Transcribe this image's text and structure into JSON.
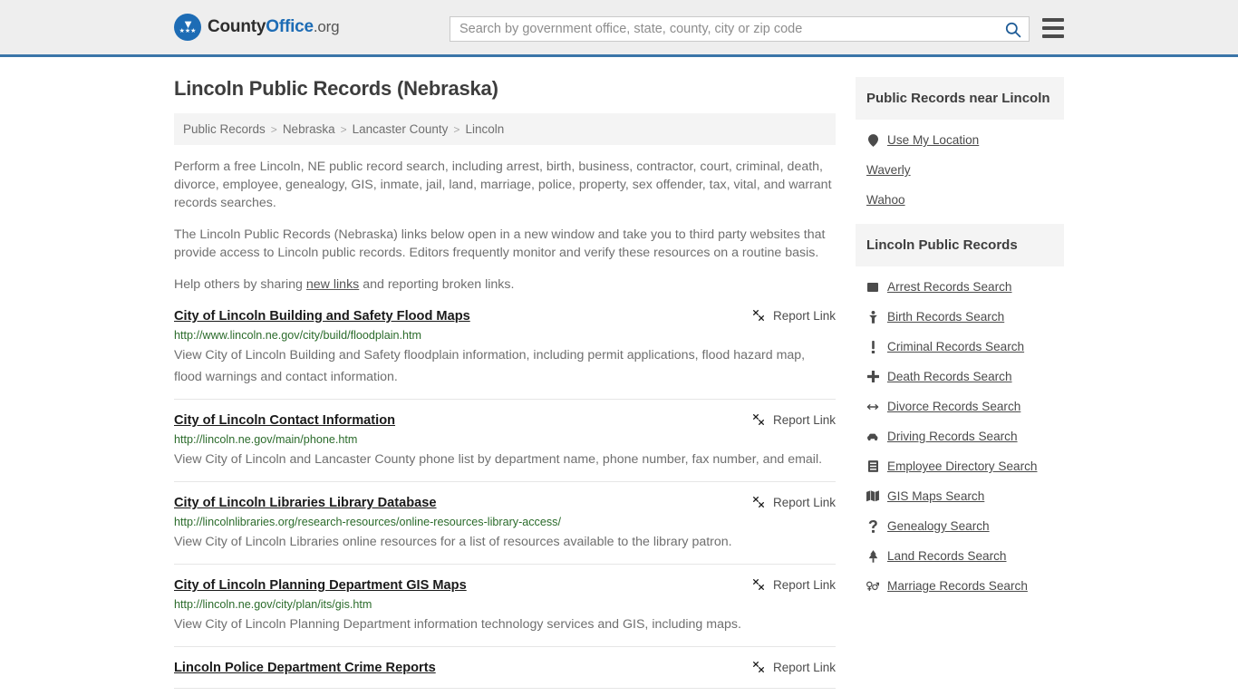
{
  "header": {
    "logo": {
      "part1": "County",
      "part2": "Office",
      "suffix": ".org",
      "icon": "eagle-shield-logo"
    },
    "search": {
      "placeholder": "Search by government office, state, county, city or zip code",
      "value": "",
      "icon": "search-icon"
    },
    "menu_icon": "hamburger-menu-icon",
    "accent_color": "#3a75a8"
  },
  "page": {
    "title": "Lincoln Public Records (Nebraska)"
  },
  "breadcrumb": {
    "items": [
      {
        "label": "Public Records",
        "link": true
      },
      {
        "label": "Nebraska",
        "link": true
      },
      {
        "label": "Lancaster County",
        "link": true
      },
      {
        "label": "Lincoln",
        "link": false
      }
    ],
    "separator": ">"
  },
  "intro": {
    "paragraph1": "Perform a free Lincoln, NE public record search, including arrest, birth, business, contractor, court, criminal, death, divorce, employee, genealogy, GIS, inmate, jail, land, marriage, police, property, sex offender, tax, vital, and warrant records searches.",
    "paragraph2": "The Lincoln Public Records (Nebraska) links below open in a new window and take you to third party websites that provide access to Lincoln public records. Editors frequently monitor and verify these resources on a routine basis.",
    "paragraph3_before": "Help others by sharing ",
    "paragraph3_link": "new links",
    "paragraph3_after": " and reporting broken links."
  },
  "results": {
    "report_label": "Report Link",
    "report_icon": "broken-link-icon",
    "items": [
      {
        "title": "City of Lincoln Building and Safety Flood Maps",
        "url": "http://www.lincoln.ne.gov/city/build/floodplain.htm",
        "description": "View City of Lincoln Building and Safety floodplain information, including permit applications, flood hazard map, flood warnings and contact information."
      },
      {
        "title": "City of Lincoln Contact Information",
        "url": "http://lincoln.ne.gov/main/phone.htm",
        "description": "View City of Lincoln and Lancaster County phone list by department name, phone number, fax number, and email."
      },
      {
        "title": "City of Lincoln Libraries Library Database",
        "url": "http://lincolnlibraries.org/research-resources/online-resources-library-access/",
        "description": "View City of Lincoln Libraries online resources for a list of resources available to the library patron."
      },
      {
        "title": "City of Lincoln Planning Department GIS Maps",
        "url": "http://lincoln.ne.gov/city/plan/its/gis.htm",
        "description": "View City of Lincoln Planning Department information technology services and GIS, including maps."
      },
      {
        "title": "Lincoln Police Department Crime Reports",
        "url": "",
        "description": ""
      }
    ]
  },
  "sidebar": {
    "near_panel": {
      "title": "Public Records near Lincoln",
      "items": [
        {
          "label": "Use My Location",
          "icon": "map-pin-icon"
        },
        {
          "label": "Waverly",
          "icon": ""
        },
        {
          "label": "Wahoo",
          "icon": ""
        }
      ]
    },
    "records_panel": {
      "title": "Lincoln Public Records",
      "items": [
        {
          "label": "Arrest Records Search",
          "icon": "fingerprint-icon"
        },
        {
          "label": "Birth Records Search",
          "icon": "baby-icon"
        },
        {
          "label": "Criminal Records Search",
          "icon": "exclamation-icon"
        },
        {
          "label": "Death Records Search",
          "icon": "cross-icon"
        },
        {
          "label": "Divorce Records Search",
          "icon": "arrows-horizontal-icon"
        },
        {
          "label": "Driving Records Search",
          "icon": "car-icon"
        },
        {
          "label": "Employee Directory Search",
          "icon": "id-card-icon"
        },
        {
          "label": "GIS Maps Search",
          "icon": "map-icon"
        },
        {
          "label": "Genealogy Search",
          "icon": "question-mark-icon"
        },
        {
          "label": "Land Records Search",
          "icon": "tree-icon"
        },
        {
          "label": "Marriage Records Search",
          "icon": "gender-symbols-icon"
        }
      ]
    }
  }
}
